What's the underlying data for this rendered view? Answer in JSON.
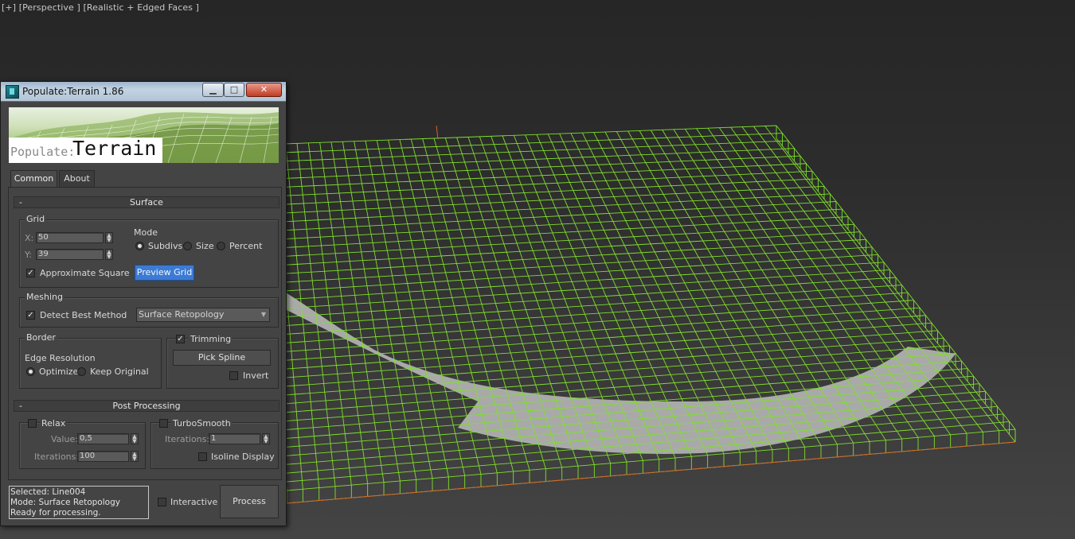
{
  "viewport": {
    "label": "[+] [Perspective ] [Realistic + Edged Faces ]"
  },
  "dialog": {
    "title": "Populate:Terrain 1.86",
    "window_buttons": {
      "minimize": "▁",
      "maximize": "□",
      "close": "✕"
    },
    "banner": {
      "brand": "Populate:",
      "product": "Terrain"
    },
    "tabs": [
      {
        "label": "Common",
        "active": true
      },
      {
        "label": "About",
        "active": false
      }
    ],
    "surface": {
      "header": "Surface",
      "collapse": "-",
      "grid": {
        "label": "Grid",
        "x_label": "X:",
        "x_value": "50",
        "y_label": "Y:",
        "y_value": "39",
        "mode_label": "Mode",
        "modes": [
          {
            "label": "Subdivs",
            "selected": true
          },
          {
            "label": "Size",
            "selected": false
          },
          {
            "label": "Percent",
            "selected": false
          }
        ],
        "approximate_square": {
          "label": "Approximate Square",
          "checked": true
        },
        "preview_button": "Preview Grid"
      },
      "meshing": {
        "label": "Meshing",
        "detect_best": {
          "label": "Detect Best Method",
          "checked": true
        },
        "method": "Surface Retopology"
      },
      "border": {
        "label": "Border",
        "edge_resolution_label": "Edge Resolution",
        "options": [
          {
            "label": "Optimize",
            "selected": true
          },
          {
            "label": "Keep Original",
            "selected": false
          }
        ]
      },
      "trimming": {
        "label": "Trimming",
        "checked": true,
        "pick_spline": "Pick Spline",
        "invert": {
          "label": "Invert",
          "checked": false
        }
      }
    },
    "post_processing": {
      "header": "Post Processing",
      "collapse": "-",
      "relax": {
        "label": "Relax",
        "checked": false,
        "value_label": "Value:",
        "value": "0,5",
        "iterations_label": "Iterations:",
        "iterations": "100"
      },
      "turbosmooth": {
        "label": "TurboSmooth",
        "checked": false,
        "iterations_label": "Iterations:",
        "iterations": "1",
        "isoline": {
          "label": "Isoline Display",
          "checked": false
        }
      }
    },
    "status": {
      "line1": "Selected: Line004",
      "line2": "Mode: Surface Retopology",
      "line3": "Ready for processing."
    },
    "interactive": {
      "label": "Interactive",
      "checked": false
    },
    "process_button": "Process"
  },
  "colors": {
    "wire": "#7ee02a",
    "surface": "#a9a9a9",
    "accent_button": "#3b7bd5"
  }
}
